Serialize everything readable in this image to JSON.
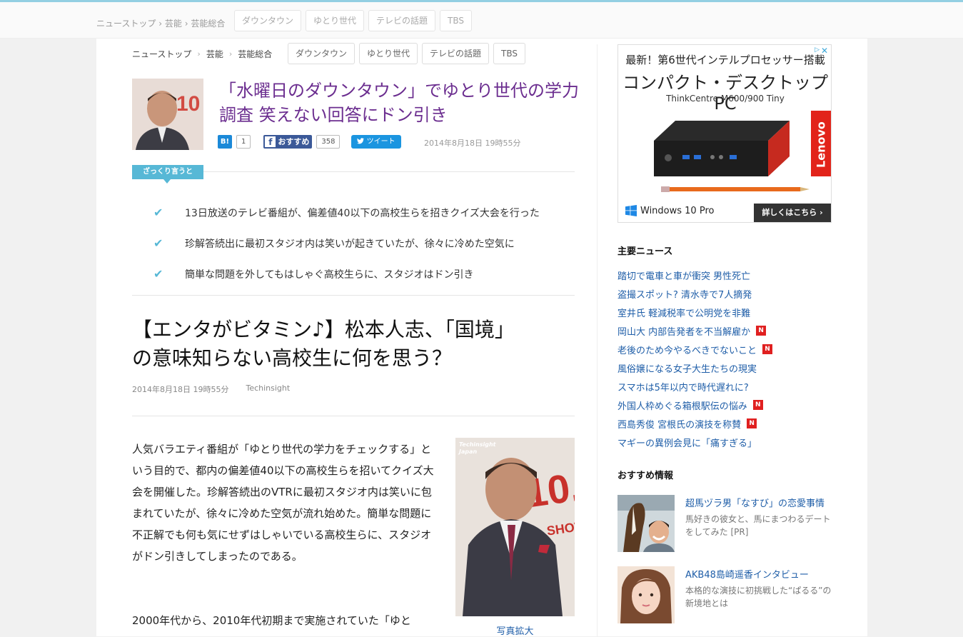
{
  "ghost_header": {
    "breadcrumb": [
      "ニューストップ",
      "芸能",
      "芸能総合"
    ],
    "tags": [
      "ダウンタウン",
      "ゆとり世代",
      "テレビの話題",
      "TBS"
    ]
  },
  "breadcrumb": {
    "items": [
      "ニューストップ",
      "芸能",
      "芸能総合"
    ],
    "separator": "›"
  },
  "tags": [
    "ダウンタウン",
    "ゆとり世代",
    "テレビの話題",
    "TBS"
  ],
  "headline": {
    "title": "「水曜日のダウンタウン」でゆとり世代の学力調査 笑えない回答にドン引き",
    "date": "2014年8月18日 19時55分"
  },
  "share": {
    "hatena_icon": "B!",
    "hatena_count": "1",
    "fb_icon": "f",
    "fb_label": "おすすめ",
    "fb_count": "358",
    "tweet_label": "ツイート"
  },
  "summary": {
    "label": "ざっくり言うと",
    "check_glyph": "✔",
    "items": [
      "13日放送のテレビ番組が、偏差値40以下の高校生らを招きクイズ大会を行った",
      "珍解答続出に最初スタジオ内は笑いが起きていたが、徐々に冷めた空気に",
      "簡単な問題を外してもはしゃぐ高校生らに、スタジオはドン引き"
    ]
  },
  "article": {
    "title": "【エンタがビタミン♪】松本人志、「国境」の意味知らない高校生に何を思う？",
    "date": "2014年8月18日 19時55分",
    "source": "Techinsight",
    "paragraph1": "人気バラエティ番組が「ゆとり世代の学力をチェックする」という目的で、都内の偏差値40以下の高校生らを招いてクイズ大会を開催した。珍解答続出のVTRに最初スタジオ内は笑いに包まれていたが、徐々に冷めた空気が流れ始めた。簡単な問題に不正解でも何も気にせずはしゃいでいる高校生らに、スタジオがドン引きしてしまったのである。",
    "paragraph2": "2000年代から、2010年代初期まで実施されていた「ゆと",
    "photo_watermark": "Techinsight Japan",
    "photo_caption": "写真拡大"
  },
  "ad": {
    "line1": "最新！第6世代インテルプロセッサー搭載",
    "line2": "コンパクト・デスクトップPC",
    "line3": "ThinkCentre M600/900 Tiny",
    "brand": "Lenovo",
    "windows": "Windows 10 Pro",
    "cta": "詳しくはこちら ›",
    "close": "✕"
  },
  "sidebar": {
    "news_heading": "主要ニュース",
    "news_badge": "N",
    "news": [
      {
        "text": "踏切で電車と車が衝突 男性死亡",
        "new": false
      },
      {
        "text": "盗撮スポット? 清水寺で7人摘発",
        "new": false
      },
      {
        "text": "室井氏 軽減税率で公明党を非難",
        "new": false
      },
      {
        "text": "岡山大 内部告発者を不当解雇か",
        "new": true
      },
      {
        "text": "老後のため今やるべきでないこと",
        "new": true
      },
      {
        "text": "風俗嬢になる女子大生たちの現実",
        "new": false
      },
      {
        "text": "スマホは5年以内で時代遅れに?",
        "new": false
      },
      {
        "text": "外国人枠めぐる箱根駅伝の悩み",
        "new": true
      },
      {
        "text": "西島秀俊 宮根氏の演技を称賛",
        "new": true
      },
      {
        "text": "マギーの異例会見に「痛すぎる」",
        "new": false
      }
    ],
    "rec_heading": "おすすめ情報",
    "recommended": [
      {
        "title": "超馬ヅラ男「なすび」の恋愛事情",
        "desc": "馬好きの彼女と、馬にまつわるデートをしてみた [PR]"
      },
      {
        "title": "AKB48島崎遥香インタビュー",
        "desc": "本格的な演技に初挑戦した“ぱるる”の新境地とは"
      }
    ]
  }
}
